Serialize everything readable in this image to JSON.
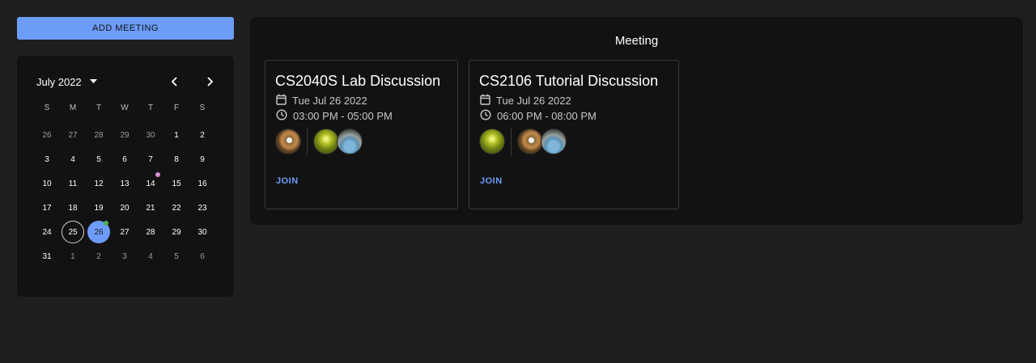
{
  "sidebar": {
    "add_meeting_label": "ADD MEETING",
    "calendar": {
      "month_label": "July 2022",
      "weekdays": [
        "S",
        "M",
        "T",
        "W",
        "T",
        "F",
        "S"
      ],
      "days": [
        {
          "label": "26",
          "out": true
        },
        {
          "label": "27",
          "out": true
        },
        {
          "label": "28",
          "out": true
        },
        {
          "label": "29",
          "out": true
        },
        {
          "label": "30",
          "out": true
        },
        {
          "label": "1"
        },
        {
          "label": "2"
        },
        {
          "label": "3"
        },
        {
          "label": "4"
        },
        {
          "label": "5"
        },
        {
          "label": "6"
        },
        {
          "label": "7"
        },
        {
          "label": "8"
        },
        {
          "label": "9"
        },
        {
          "label": "10"
        },
        {
          "label": "11"
        },
        {
          "label": "12"
        },
        {
          "label": "13"
        },
        {
          "label": "14",
          "dot": "#d98fd6"
        },
        {
          "label": "15"
        },
        {
          "label": "16"
        },
        {
          "label": "17"
        },
        {
          "label": "18"
        },
        {
          "label": "19"
        },
        {
          "label": "20"
        },
        {
          "label": "21"
        },
        {
          "label": "22"
        },
        {
          "label": "23"
        },
        {
          "label": "24"
        },
        {
          "label": "25",
          "today": true
        },
        {
          "label": "26",
          "selected": true,
          "dot": "#4caf50"
        },
        {
          "label": "27"
        },
        {
          "label": "28"
        },
        {
          "label": "29"
        },
        {
          "label": "30"
        },
        {
          "label": "31"
        },
        {
          "label": "1",
          "out": true
        },
        {
          "label": "2",
          "out": true
        },
        {
          "label": "3",
          "out": true
        },
        {
          "label": "4",
          "out": true
        },
        {
          "label": "5",
          "out": true
        },
        {
          "label": "6",
          "out": true
        }
      ]
    }
  },
  "main": {
    "title": "Meeting",
    "meetings": [
      {
        "title": "CS2040S Lab Discussion",
        "date": "Tue Jul 26 2022",
        "time": "03:00 PM - 05:00 PM",
        "host_avatar": "av-a",
        "participant_avatars": [
          "av-b",
          "av-c"
        ],
        "join_label": "JOIN"
      },
      {
        "title": "CS2106 Tutorial Discussion",
        "date": "Tue Jul 26 2022",
        "time": "06:00 PM - 08:00 PM",
        "host_avatar": "av-b",
        "participant_avatars": [
          "av-a",
          "av-c"
        ],
        "join_label": "JOIN"
      }
    ]
  },
  "colors": {
    "accent": "#6c9cf8",
    "background": "#1f1f1f",
    "surface": "#121212",
    "dot_purple": "#d98fd6",
    "dot_green": "#4caf50"
  },
  "icons": {
    "dropdown": "caret-down-icon",
    "prev": "chevron-left-icon",
    "next": "chevron-right-icon",
    "date": "calendar-icon",
    "time": "clock-icon"
  }
}
